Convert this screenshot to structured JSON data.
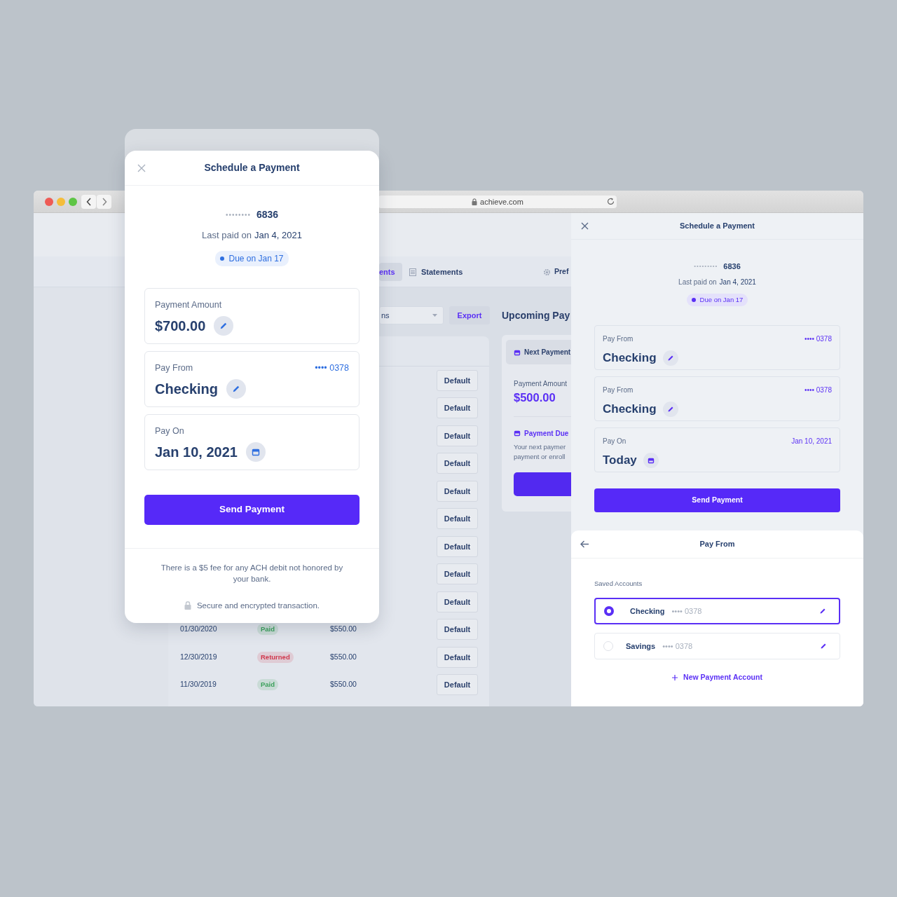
{
  "browser": {
    "url": "achieve.com"
  },
  "app": {
    "tabs": [
      {
        "label": "ents",
        "kind": "plain",
        "selected": true
      },
      {
        "label": "Statements",
        "kind": "statements",
        "selected": false
      },
      {
        "label": "Pref",
        "kind": "settings",
        "selected": false
      }
    ],
    "filter": {
      "value": "ns"
    },
    "export_button": "Export",
    "section_title": "Upcoming Pay",
    "history_rows": [
      {
        "action": "Default"
      },
      {
        "action": "Default"
      },
      {
        "action": "Default"
      },
      {
        "action": "Default"
      },
      {
        "action": "Default"
      },
      {
        "action": "Default"
      },
      {
        "action": "Default"
      },
      {
        "action": "Default"
      },
      {
        "action": "Default"
      },
      {
        "date": "01/30/2020",
        "status": "Paid",
        "color": "#3aa05a",
        "amount": "$550.00",
        "action": "Default"
      },
      {
        "date": "12/30/2019",
        "status": "Returned",
        "color": "#d0384d",
        "amount": "$550.00",
        "action": "Default"
      },
      {
        "date": "11/30/2019",
        "status": "Paid",
        "color": "#3aa05a",
        "amount": "$550.00",
        "action": "Default"
      }
    ],
    "upcoming_card": {
      "header": "Next Payment",
      "amount_label": "Payment Amount",
      "amount": "$500.00",
      "due_label": "Payment Due",
      "due_lines": [
        "Your next paymer",
        "payment or enroll"
      ]
    }
  },
  "modal": {
    "title": "Schedule a Payment",
    "account_mask": "••••••••",
    "account_last4": "6836",
    "last_paid_label": "Last paid on",
    "last_paid_date": "Jan 4, 2021",
    "due_badge": "Due on Jan 17",
    "fields": [
      {
        "kind": "amount",
        "label": "Payment Amount",
        "value": "$700.00"
      },
      {
        "kind": "account",
        "label": "Pay From",
        "value": "Checking",
        "detail": "•••• 0378"
      },
      {
        "kind": "date",
        "label": "Pay On",
        "value": "Jan 10, 2021"
      }
    ],
    "submit": "Send Payment",
    "fee_note": "There is a $5 fee for any ACH debit not honored by your bank.",
    "secure_note": "Secure and encrypted transaction."
  },
  "side_panel": {
    "title": "Schedule a Payment",
    "account_mask": "•••••••••",
    "account_last4": "6836",
    "last_paid_label": "Last paid on",
    "last_paid_date": "Jan 4, 2021",
    "due_badge": "Due on Jan 17",
    "fields": [
      {
        "kind": "account",
        "label": "Pay From",
        "value": "Checking",
        "detail": "•••• 0378"
      },
      {
        "kind": "account",
        "label": "Pay From",
        "value": "Checking",
        "detail": "•••• 0378"
      },
      {
        "kind": "date",
        "label": "Pay On",
        "value": "Today",
        "detail": "Jan 10, 2021"
      }
    ],
    "submit": "Send Payment"
  },
  "pay_from_sheet": {
    "title": "Pay From",
    "section_label": "Saved Accounts",
    "accounts": [
      {
        "name": "Checking",
        "mask": "•••• 0378",
        "selected": true
      },
      {
        "name": "Savings",
        "mask": "•••• 0378",
        "selected": false
      }
    ],
    "add_link": "New Payment Account"
  }
}
